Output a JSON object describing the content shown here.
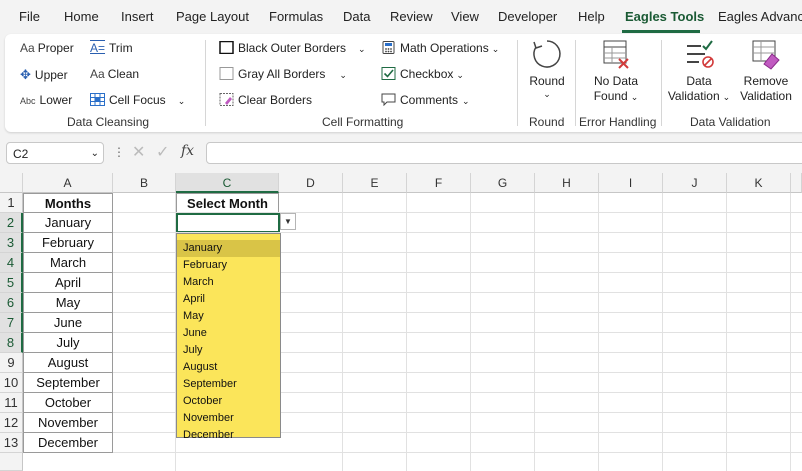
{
  "menu": {
    "tabs": [
      "File",
      "Home",
      "Insert",
      "Page Layout",
      "Formulas",
      "Data",
      "Review",
      "View",
      "Developer",
      "Help",
      "Eagles Tools",
      "Eagles Advanc"
    ],
    "active": "Eagles Tools"
  },
  "ribbon": {
    "data_cleansing": {
      "label": "Data Cleansing",
      "proper": "Proper",
      "trim": "Trim",
      "upper": "Upper",
      "clean": "Clean",
      "lower": "Lower",
      "cell_focus": "Cell Focus"
    },
    "cell_formatting": {
      "label": "Cell Formatting",
      "black_outer_borders": "Black Outer Borders",
      "gray_all_borders": "Gray All Borders",
      "clear_borders": "Clear Borders",
      "math_operations": "Math Operations",
      "checkbox": "Checkbox",
      "comments": "Comments"
    },
    "round": {
      "label": "Round",
      "button": "Round"
    },
    "error_handling": {
      "label": "Error Handling",
      "button_line1": "No Data",
      "button_line2": "Found"
    },
    "data_validation": {
      "label": "Data Validation",
      "dv_line1": "Data",
      "dv_line2": "Validation",
      "remove_line1": "Remove",
      "remove_line2": "Validation"
    }
  },
  "formula_bar": {
    "name_box": "C2",
    "fx": "fx",
    "content": ""
  },
  "columns": [
    "A",
    "B",
    "C",
    "D",
    "E",
    "F",
    "G",
    "H",
    "I",
    "J",
    "K"
  ],
  "rows": [
    "1",
    "2",
    "3",
    "4",
    "5",
    "6",
    "7",
    "8",
    "9",
    "10",
    "11",
    "12",
    "13",
    ""
  ],
  "sheet": {
    "a1": "Months",
    "months": [
      "January",
      "February",
      "March",
      "April",
      "May",
      "June",
      "July",
      "August",
      "September",
      "October",
      "November",
      "December"
    ],
    "c1": "Select Month"
  },
  "dropdown": {
    "items": [
      "January",
      "February",
      "March",
      "April",
      "May",
      "June",
      "July",
      "August",
      "September",
      "October",
      "November",
      "December"
    ],
    "highlighted": "January"
  },
  "colors": {
    "accent": "#1f6b43",
    "dropdown_bg": "#fbe55a",
    "dropdown_highlight": "#d9c447"
  }
}
